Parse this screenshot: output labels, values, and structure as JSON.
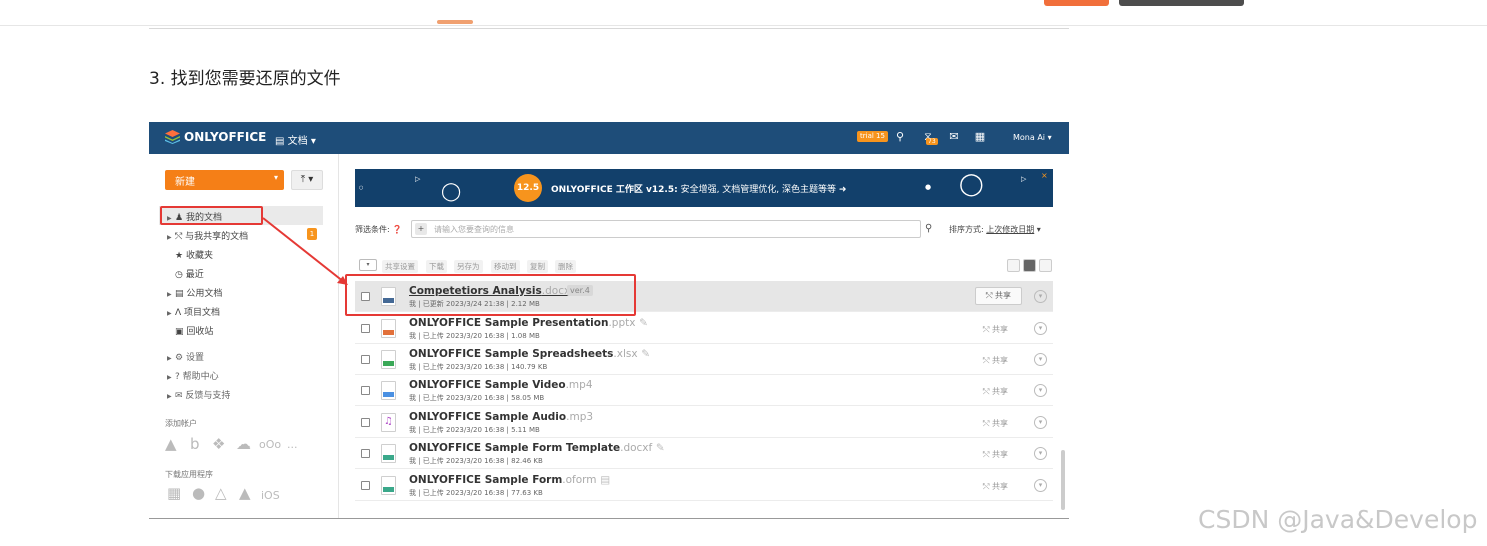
{
  "page": {
    "step_text": "3. 找到您需要还原的文件",
    "watermark": "CSDN @Java&Develop"
  },
  "app": {
    "logo": "ONLYOFFICE",
    "module": "文档",
    "trial": "trial 15",
    "notif_count": "73",
    "user": "Mona Ai",
    "brand_color": "#1e4d79",
    "accent_color": "#f57f17"
  },
  "sidebar": {
    "new_button": "新建",
    "items": [
      {
        "label": "我的文档",
        "icon": "user-icon"
      },
      {
        "label": "与我共享的文档",
        "icon": "share-icon"
      },
      {
        "label": "收藏夹",
        "icon": "star-icon"
      },
      {
        "label": "最近",
        "icon": "clock-icon"
      },
      {
        "label": "公用文档",
        "icon": "common-icon"
      },
      {
        "label": "项目文档",
        "icon": "project-icon"
      },
      {
        "label": "回收站",
        "icon": "trash-icon"
      }
    ],
    "shared_badge": "1",
    "links": [
      "设置",
      "帮助中心",
      "反馈与支持"
    ],
    "add_account": "添加帐户",
    "download_apps": "下载应用程序",
    "ios_label": "iOS"
  },
  "banner": {
    "version_badge": "12.5",
    "title": "ONLYOFFICE 工作区 v12.5:",
    "text": "安全增强, 文档管理优化, 深色主题等等",
    "close": "×"
  },
  "filter": {
    "label": "筛选条件:",
    "placeholder": "请输入您要查询的信息",
    "sort_label": "排序方式:",
    "sort_value": "上次修改日期"
  },
  "toolbar": [
    "共享设置",
    "下载",
    "另存为",
    "移动到",
    "复制",
    "删除"
  ],
  "files": [
    {
      "name": "Competetiors Analysis",
      "ext": ".docx",
      "meta": "我 | 已更新 2023/3/24 21:38 | 2.12 MB",
      "type": "docx",
      "color": "#446995",
      "version": "ver.4",
      "share": "共享"
    },
    {
      "name": "ONLYOFFICE Sample Presentation",
      "ext": ".pptx",
      "meta": "我 | 已上传 2023/3/20 16:38 | 1.08 MB",
      "type": "pptx",
      "color": "#e2703a",
      "share": "共享"
    },
    {
      "name": "ONLYOFFICE Sample Spreadsheets",
      "ext": ".xlsx",
      "meta": "我 | 已上传 2023/3/20 16:38 | 140.79 KB",
      "type": "xlsx",
      "color": "#3aa857",
      "share": "共享"
    },
    {
      "name": "ONLYOFFICE Sample Video",
      "ext": ".mp4",
      "meta": "我 | 已上传 2023/3/20 16:38 | 58.05 MB",
      "type": "mp4",
      "color": "#4a90e2",
      "share": "共享"
    },
    {
      "name": "ONLYOFFICE Sample Audio",
      "ext": ".mp3",
      "meta": "我 | 已上传 2023/3/20 16:38 | 5.11 MB",
      "type": "mp3",
      "color": "#b04cc8",
      "share": "共享"
    },
    {
      "name": "ONLYOFFICE Sample Form Template",
      "ext": ".docxf",
      "meta": "我 | 已上传 2023/3/20 16:38 | 82.46 KB",
      "type": "docxf",
      "color": "#3aa88a",
      "share": "共享"
    },
    {
      "name": "ONLYOFFICE Sample Form",
      "ext": ".oform",
      "meta": "我 | 已上传 2023/3/20 16:38 | 77.63 KB",
      "type": "oform",
      "color": "#3aa88a",
      "share": "共享"
    }
  ]
}
